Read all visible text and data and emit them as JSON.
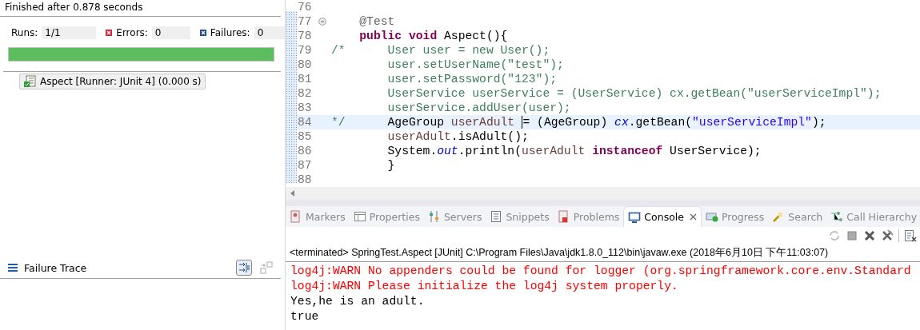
{
  "junit": {
    "status": "Finished after 0.878 seconds",
    "counters": [
      {
        "kind": "runs",
        "label": "Runs:",
        "value": "1/1"
      },
      {
        "kind": "errors",
        "label": "Errors:",
        "value": "0"
      },
      {
        "kind": "failures",
        "label": "Failures:",
        "value": "0"
      }
    ],
    "progress": {
      "level": 1
    },
    "tests": [
      {
        "label": "Aspect [Runner: JUnit 4] (0.000 s)",
        "selected": true
      }
    ],
    "failure_trace": {
      "title": "Failure Trace"
    }
  },
  "editor": {
    "lines": [
      {
        "number": "76",
        "fold": false,
        "current": false
      },
      {
        "number": "77",
        "fold": true,
        "current": false,
        "kind": "method",
        "tokens": [
          {
            "kind": "annotation",
            "text": "@Test"
          }
        ]
      },
      {
        "number": "78",
        "fold": false,
        "current": false,
        "kind": "method",
        "tokens": [
          {
            "kind": "keyword",
            "text": "public "
          },
          {
            "kind": "keyword",
            "text": "void "
          },
          {
            "kind": "plain",
            "text": "Aspect(){"
          }
        ]
      },
      {
        "number": "79",
        "fold": false,
        "current": false,
        "tokens": [
          {
            "kind": "comment",
            "text": "/*      User user = new User();"
          }
        ]
      },
      {
        "number": "80",
        "fold": false,
        "current": false,
        "tokens": [
          {
            "kind": "comment",
            "text": "        user.setUserName(\"test\");"
          }
        ]
      },
      {
        "number": "81",
        "fold": false,
        "current": false,
        "tokens": [
          {
            "kind": "comment",
            "text": "        user.setPassword(\"123\");"
          }
        ]
      },
      {
        "number": "82",
        "fold": false,
        "current": false,
        "tokens": [
          {
            "kind": "comment",
            "text": "        UserService userService = (UserService) cx.getBean(\"userServiceImpl\");"
          }
        ]
      },
      {
        "number": "83",
        "fold": false,
        "current": false,
        "tokens": [
          {
            "kind": "comment",
            "text": "        userService.addUser(user);"
          }
        ]
      },
      {
        "number": "84",
        "fold": false,
        "current": true,
        "tokens": [
          {
            "kind": "comment",
            "text": "*/      "
          },
          {
            "kind": "plain",
            "text": "AgeGroup "
          },
          {
            "kind": "local",
            "text": "userAdult "
          },
          {
            "kind": "cursor"
          },
          {
            "kind": "plain",
            "text": "= (AgeGroup) "
          },
          {
            "kind": "field",
            "text": "cx"
          },
          {
            "kind": "plain",
            "text": ".getBean("
          },
          {
            "kind": "string",
            "text": "\"userServiceImpl\""
          },
          {
            "kind": "plain",
            "text": ");"
          }
        ]
      },
      {
        "number": "85",
        "fold": false,
        "current": false,
        "kind": "body",
        "tokens": [
          {
            "kind": "local",
            "text": "userAdult"
          },
          {
            "kind": "plain",
            "text": ".isAdult();"
          }
        ]
      },
      {
        "number": "86",
        "fold": false,
        "current": false,
        "kind": "body",
        "tokens": [
          {
            "kind": "plain",
            "text": "System."
          },
          {
            "kind": "static",
            "text": "out"
          },
          {
            "kind": "plain",
            "text": ".println("
          },
          {
            "kind": "local",
            "text": "userAdult "
          },
          {
            "kind": "keyword",
            "text": "instanceof"
          },
          {
            "kind": "plain",
            "text": " UserService);"
          }
        ]
      },
      {
        "number": "87",
        "fold": false,
        "current": false,
        "kind": "body",
        "tokens": [
          {
            "kind": "plain",
            "text": "}"
          }
        ]
      },
      {
        "number": "88",
        "fold": false,
        "current": false
      }
    ]
  },
  "views": {
    "tabs": [
      {
        "kind": "markers",
        "label": "Markers",
        "selected": false
      },
      {
        "kind": "properties",
        "label": "Properties",
        "selected": false
      },
      {
        "kind": "servers",
        "label": "Servers",
        "selected": false
      },
      {
        "kind": "snippets",
        "label": "Snippets",
        "selected": false
      },
      {
        "kind": "problems",
        "label": "Problems",
        "selected": false
      },
      {
        "kind": "console",
        "label": "Console",
        "selected": true
      },
      {
        "kind": "progress",
        "label": "Progress",
        "selected": false
      },
      {
        "kind": "search",
        "label": "Search",
        "selected": false
      },
      {
        "kind": "hierarchy",
        "label": "Call Hierarchy",
        "selected": false
      }
    ],
    "console": {
      "header": "<terminated> SpringTest.Aspect [JUnit] C:\\Program Files\\Java\\jdk1.8.0_112\\bin\\javaw.exe (2018年6月10日 下午11:03:07)",
      "output": [
        {
          "kind": "error",
          "text": "log4j:WARN No appenders could be found for logger (org.springframework.core.env.Standard"
        },
        {
          "kind": "error",
          "text": "log4j:WARN Please initialize the log4j system properly."
        },
        {
          "kind": "out",
          "text": "Yes,he is an adult."
        },
        {
          "kind": "out",
          "text": "true"
        }
      ]
    }
  }
}
